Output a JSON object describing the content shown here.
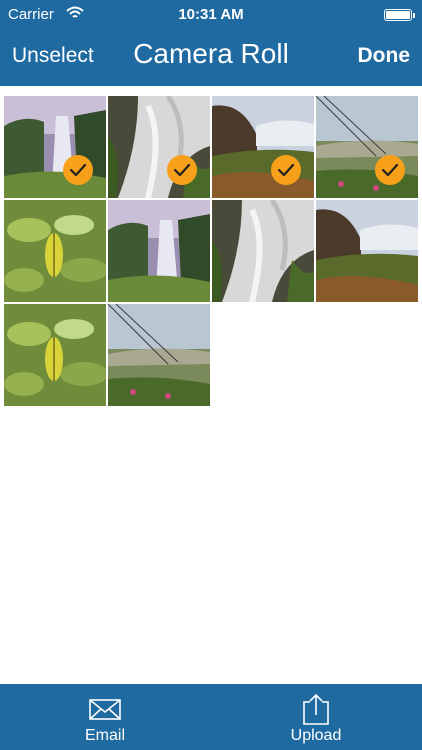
{
  "status_bar": {
    "carrier": "Carrier",
    "time": "10:31 AM"
  },
  "nav": {
    "left_button": "Unselect",
    "title": "Camera Roll",
    "right_button": "Done"
  },
  "photos": [
    {
      "scene": "waterfall-valley",
      "selected": true
    },
    {
      "scene": "cascade-closeup",
      "selected": true
    },
    {
      "scene": "waterfall-mist-mossy",
      "selected": true
    },
    {
      "scene": "meadow-wires",
      "selected": true
    },
    {
      "scene": "green-leaves",
      "selected": false
    },
    {
      "scene": "waterfall-valley",
      "selected": false
    },
    {
      "scene": "cascade-closeup",
      "selected": false
    },
    {
      "scene": "waterfall-mist-mossy",
      "selected": false
    },
    {
      "scene": "green-leaves",
      "selected": false
    },
    {
      "scene": "meadow-wires",
      "selected": false
    }
  ],
  "toolbar": {
    "email_label": "Email",
    "upload_label": "Upload"
  },
  "colors": {
    "bar": "#1f6aa1",
    "selection_badge": "#f7a11a"
  },
  "icons": {
    "email": "envelope-icon",
    "upload": "upload-icon",
    "check": "checkmark-icon"
  }
}
